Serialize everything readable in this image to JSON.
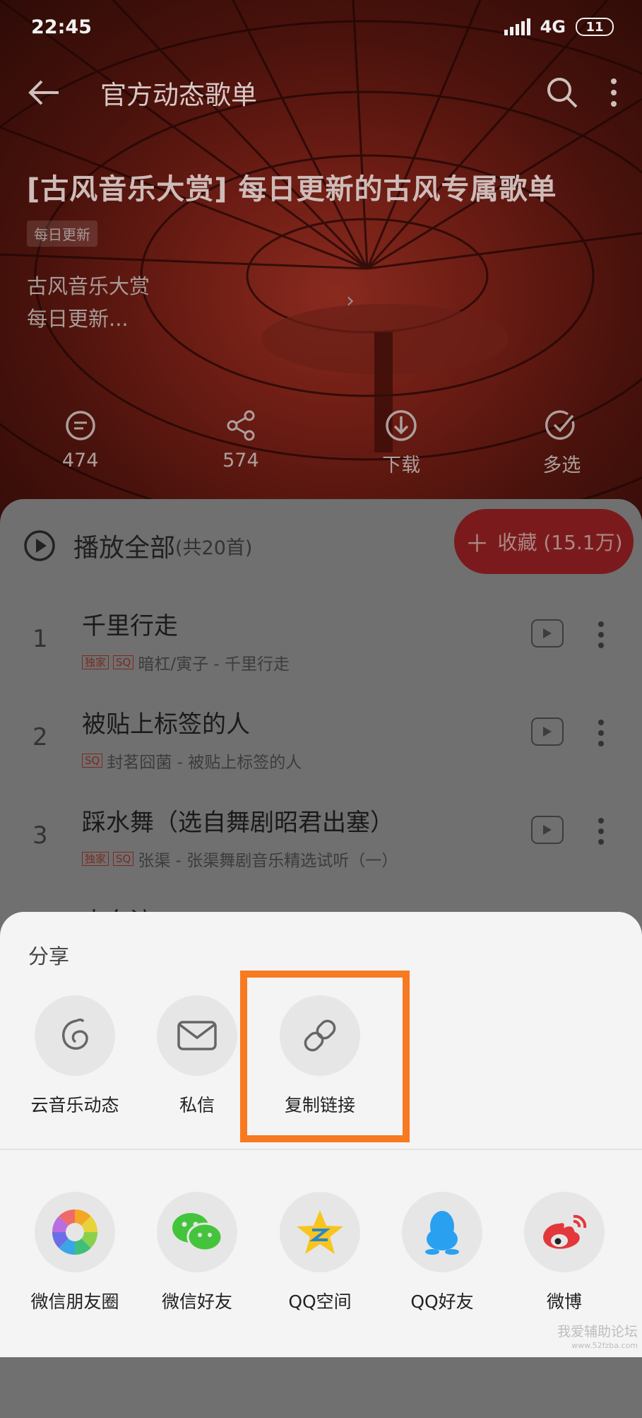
{
  "status": {
    "time": "22:45",
    "network": "4G",
    "battery": "11"
  },
  "header": {
    "title": "官方动态歌单"
  },
  "playlist": {
    "title": "[古风音乐大赏] 每日更新的古风专属歌单",
    "tag": "每日更新",
    "desc_line1": "古风音乐大赏",
    "desc_line2": "每日更新..."
  },
  "actions": {
    "comments": "474",
    "share": "574",
    "download": "下载",
    "multiselect": "多选"
  },
  "list": {
    "play_all": "播放全部",
    "count": "(共20首)",
    "collect": "收藏 (15.1万)",
    "songs": [
      {
        "num": "1",
        "name": "千里行走",
        "exclusive": "独家",
        "sq": "SQ",
        "artist": "暗杠/寅子 - 千里行走"
      },
      {
        "num": "2",
        "name": "被贴上标签的人",
        "sq": "SQ",
        "artist": "封茗囧菌 - 被贴上标签的人"
      },
      {
        "num": "3",
        "name": "踩水舞（选自舞剧昭君出塞）",
        "exclusive": "独家",
        "sq": "SQ",
        "artist": "张渠 - 张渠舞剧音乐精选试听（一）"
      },
      {
        "num": "",
        "name": "水东流"
      }
    ]
  },
  "share": {
    "title": "分享",
    "row1": [
      "云音乐动态",
      "私信",
      "复制链接"
    ],
    "row2": [
      "微信朋友圈",
      "微信好友",
      "QQ空间",
      "QQ好友",
      "微博"
    ]
  },
  "watermark": {
    "line1": "我爱辅助论坛",
    "line2": "www.52fzba.com"
  },
  "colors": {
    "accent_red": "#7b1a1c",
    "highlight": "#f77a21"
  }
}
